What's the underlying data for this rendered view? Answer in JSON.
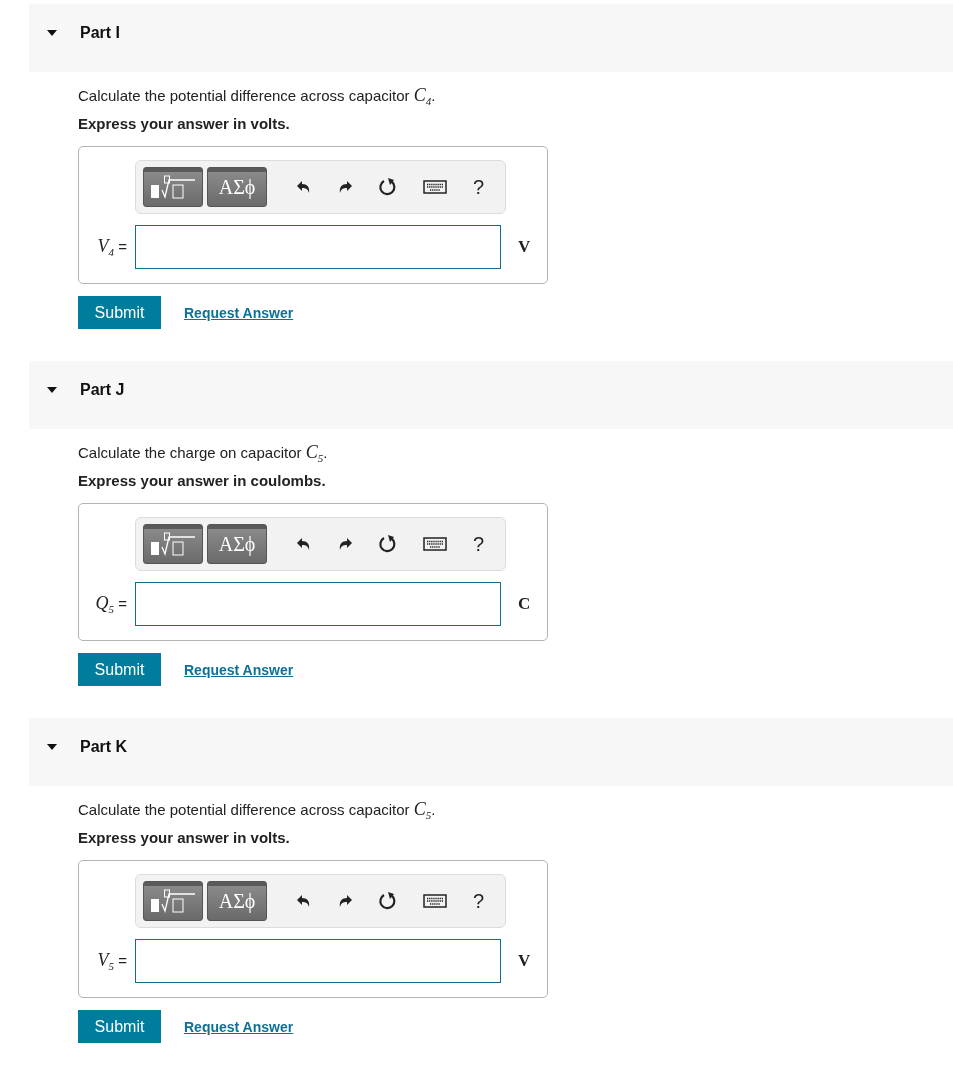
{
  "parts": [
    {
      "title": "Part I",
      "expanded": true,
      "prompt": "Calculate the potential difference across capacitor *C*$_{4}$.",
      "instruction": "Express your answer in volts.",
      "toolbar": {
        "symbols": "ΑΣϕ",
        "help": "?"
      },
      "variable": "*V*$_{4}$ =",
      "unit": "V",
      "submit": "Submit",
      "request": "Request Answer"
    },
    {
      "title": "Part J",
      "expanded": true,
      "prompt": "Calculate the charge on capacitor *C*$_{5}$.",
      "instruction": "Express your answer in coulombs.",
      "toolbar": {
        "symbols": "ΑΣϕ",
        "help": "?"
      },
      "variable": "*Q*$_{5}$ =",
      "unit": "C",
      "submit": "Submit",
      "request": "Request Answer"
    },
    {
      "title": "Part K",
      "expanded": true,
      "prompt": "Calculate the potential difference across capacitor *C*$_{5}$.",
      "instruction": "Express your answer in volts.",
      "toolbar": {
        "symbols": "ΑΣϕ",
        "help": "?"
      },
      "variable": "*V*$_{5}$ =",
      "unit": "V",
      "submit": "Submit",
      "request": "Request Answer"
    }
  ]
}
